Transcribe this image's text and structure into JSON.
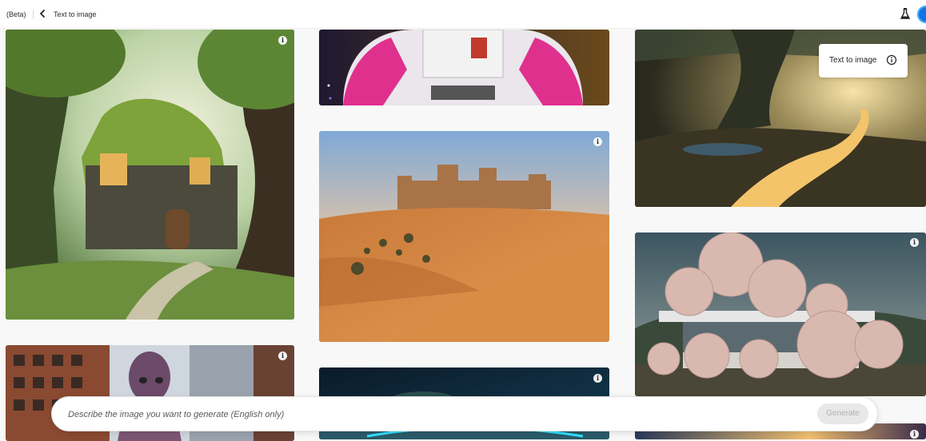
{
  "header": {
    "beta_label": "(Beta)",
    "breadcrumb": "Text to image",
    "back_icon": "chevron-left-icon",
    "labs_icon": "flask-icon"
  },
  "tooltip": {
    "label": "Text to image",
    "icon": "info-circle-icon"
  },
  "gallery": {
    "info_glyph": "i",
    "tiles": [
      {
        "id": "fairy-house",
        "subject": "moss-covered fairy tree house in a forest"
      },
      {
        "id": "astronaut",
        "subject": "astronaut in a pink and white space suit"
      },
      {
        "id": "swamp-tree",
        "subject": "giant tree over a glowing swamp river at sunset"
      },
      {
        "id": "desert-castle",
        "subject": "sand castle on a desert dune"
      },
      {
        "id": "octopus-city",
        "subject": "octopus among city buildings"
      },
      {
        "id": "sphere-house",
        "subject": "modern house with giant pink spheres"
      },
      {
        "id": "neon-landscape",
        "subject": "neon-lit landscape"
      },
      {
        "id": "sunset-partial",
        "subject": "sunset scene"
      }
    ]
  },
  "prompt": {
    "placeholder": "Describe the image you want to generate (English only)",
    "value": "",
    "generate_label": "Generate"
  },
  "colors": {
    "accent": "#1473e6",
    "generate_disabled_bg": "#e8e8e8",
    "generate_disabled_text": "#b0b0b0"
  }
}
